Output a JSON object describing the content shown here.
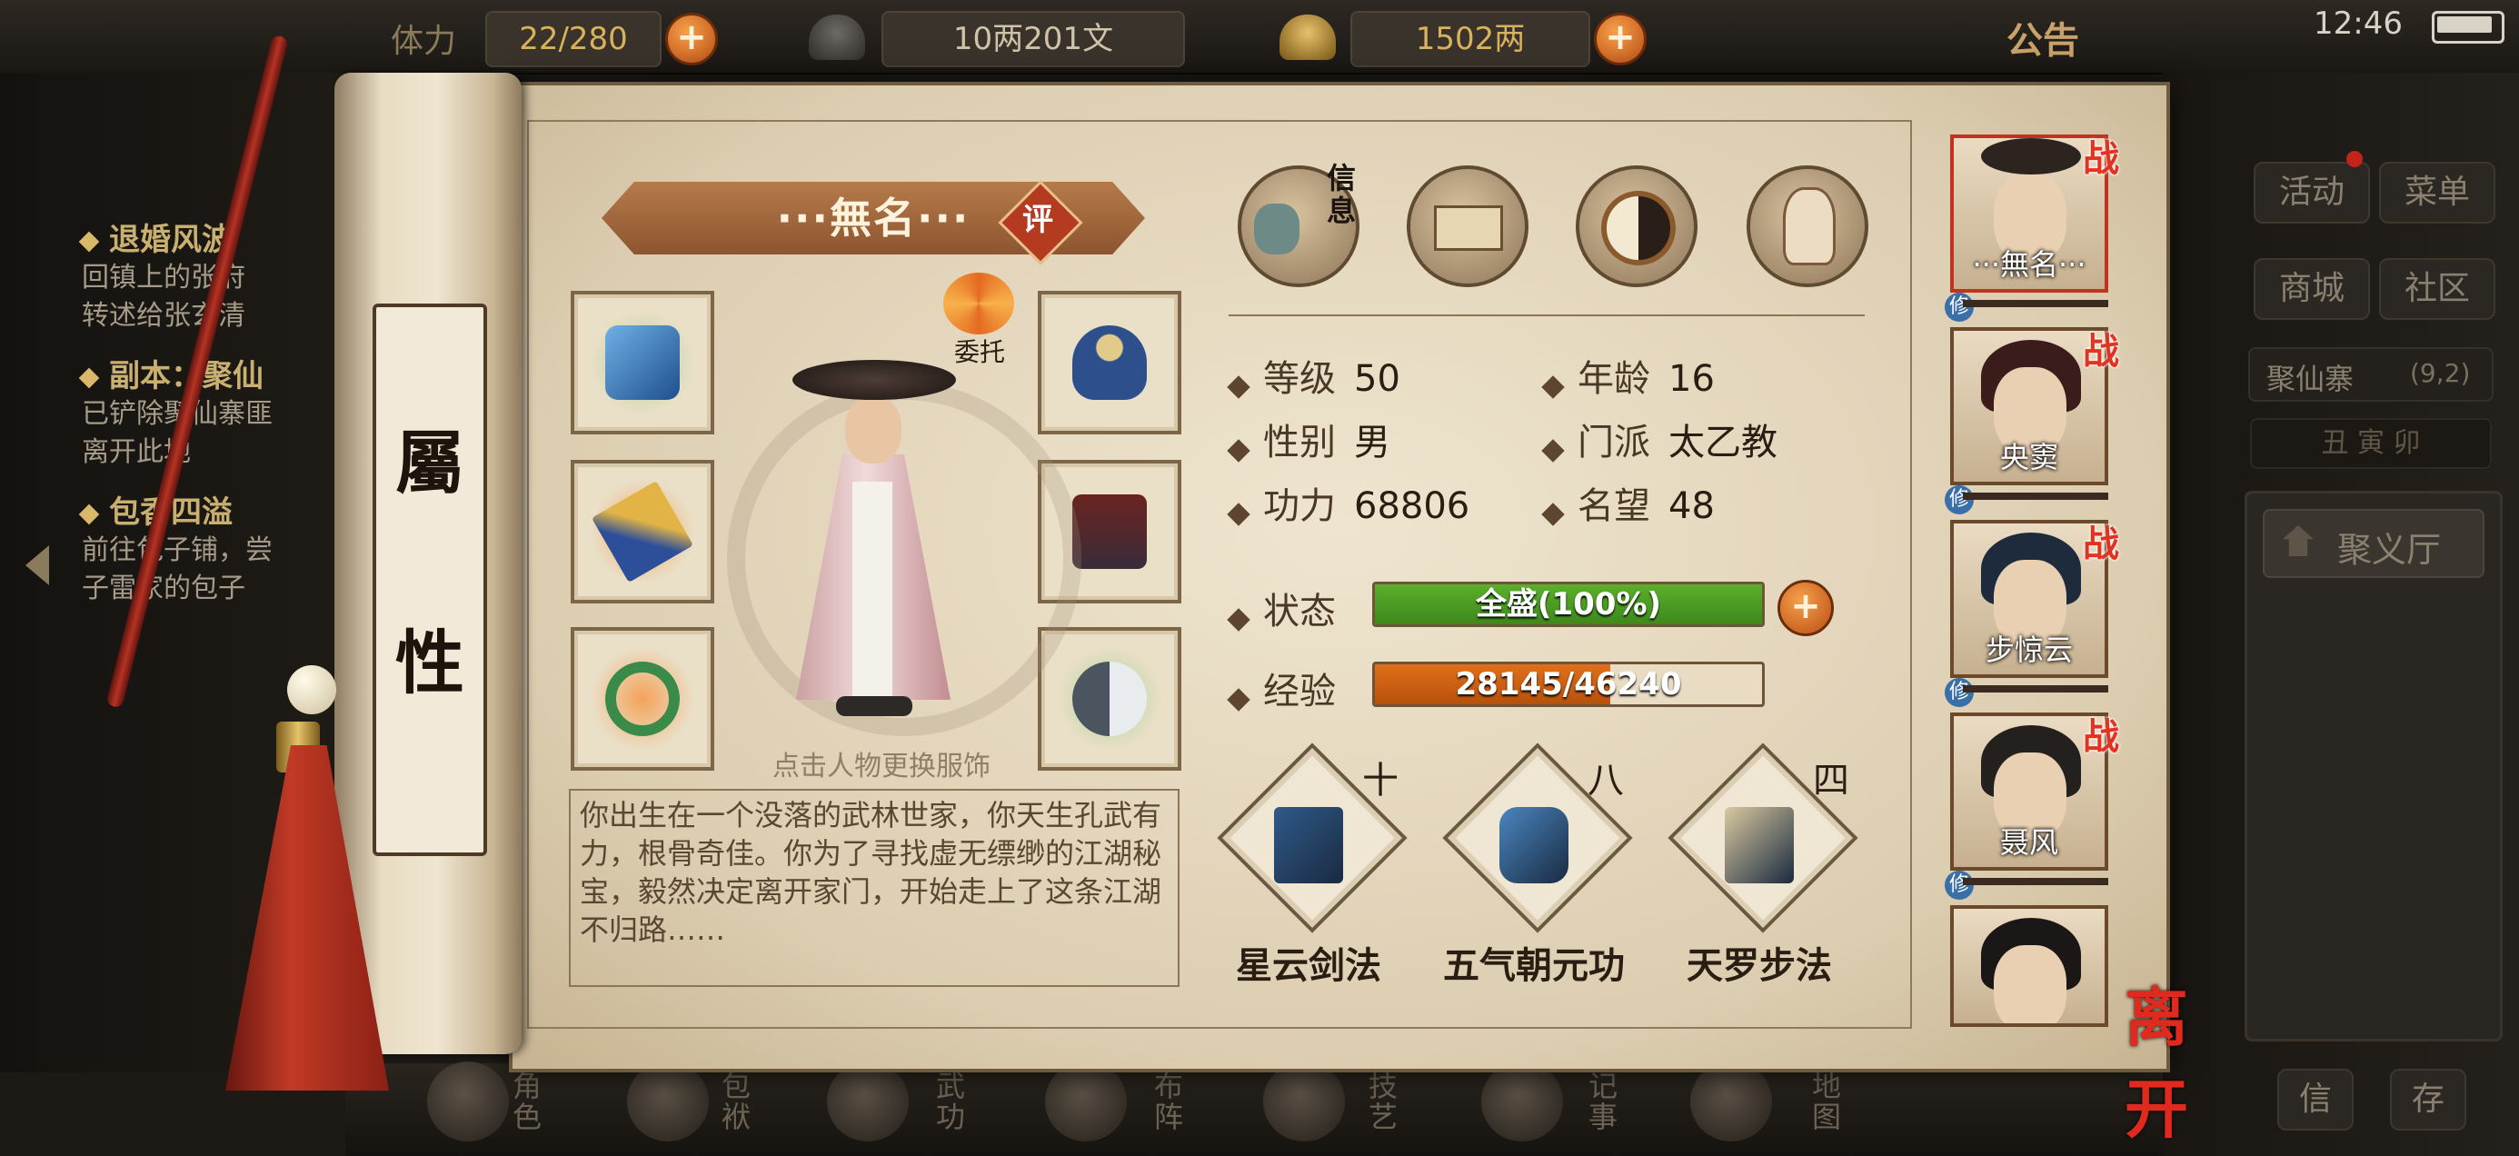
{
  "status": {
    "time": "12:46"
  },
  "top_bar": {
    "stamina_label": "体力",
    "stamina_value": "22/280",
    "silver": "10两201文",
    "gold": "1502两",
    "announcement": "公告"
  },
  "quests": [
    {
      "title": "退婚风波",
      "lines": [
        "回镇上的张府",
        "转述给张玄清"
      ]
    },
    {
      "title": "副本：聚仙",
      "lines": [
        "已铲除聚仙寨匪",
        "离开此地"
      ]
    },
    {
      "title": "包香四溢",
      "lines": [
        "前往包子铺，尝",
        "子雷家的包子"
      ]
    }
  ],
  "side_menu": {
    "activity": "活动",
    "menu": "菜单",
    "shop": "商城",
    "community": "社区",
    "location_name": "聚仙寨",
    "location_coords": "(9,2)",
    "time_branches": "丑 寅 卯",
    "hall": "聚义厅",
    "chat1": "信",
    "chat2": "存"
  },
  "bottom_nav": [
    "角色",
    "包袱",
    "武功",
    "布阵",
    "技艺",
    "记事",
    "地图"
  ],
  "scroll": {
    "char1": "屬",
    "char2": "性"
  },
  "character": {
    "name": "···無名···",
    "rate_badge": "评",
    "entrust_label": "委托",
    "change_outfit_hint": "点击人物更换服饰",
    "bio": "你出生在一个没落的武林世家，你天生孔武有力，根骨奇佳。你为了寻找虚无缥缈的江湖秘宝，毅然决定离开家门，开始走上了这条江湖不归路……"
  },
  "tabs": {
    "info_label": "信息"
  },
  "stats": {
    "level_label": "等级",
    "level": "50",
    "age_label": "年龄",
    "age": "16",
    "gender_label": "性别",
    "gender": "男",
    "sect_label": "门派",
    "sect": "太乙教",
    "power_label": "功力",
    "power": "68806",
    "fame_label": "名望",
    "fame": "48",
    "state_label": "状态",
    "state_text": "全盛(100%)",
    "state_percent": 100,
    "exp_label": "经验",
    "exp_text": "28145/46240",
    "exp_current": 28145,
    "exp_max": 46240
  },
  "skills": [
    {
      "name": "星云剑法",
      "level": "十",
      "color": "#2f5a8a"
    },
    {
      "name": "五气朝元功",
      "level": "八",
      "color": "#4a86c0"
    },
    {
      "name": "天罗步法",
      "level": "四",
      "color": "#d9c9a0"
    }
  ],
  "roster": [
    {
      "name": "···無名···",
      "war": "战",
      "hair": "#2d2420"
    },
    {
      "name": "央窦",
      "war": "战",
      "hair": "#3a1c1a"
    },
    {
      "name": "步惊云",
      "war": "战",
      "hair": "#1e2b3c"
    },
    {
      "name": "聂风",
      "war": "战",
      "hair": "#24201e"
    },
    {
      "name": "",
      "war": "",
      "hair": "#1b1716"
    }
  ],
  "roster_badge": "修",
  "leave_button": "离开",
  "colors": {
    "state_bar": "#5cae2c",
    "exp_bar": "#e0701a",
    "accent_red": "#e23222"
  }
}
